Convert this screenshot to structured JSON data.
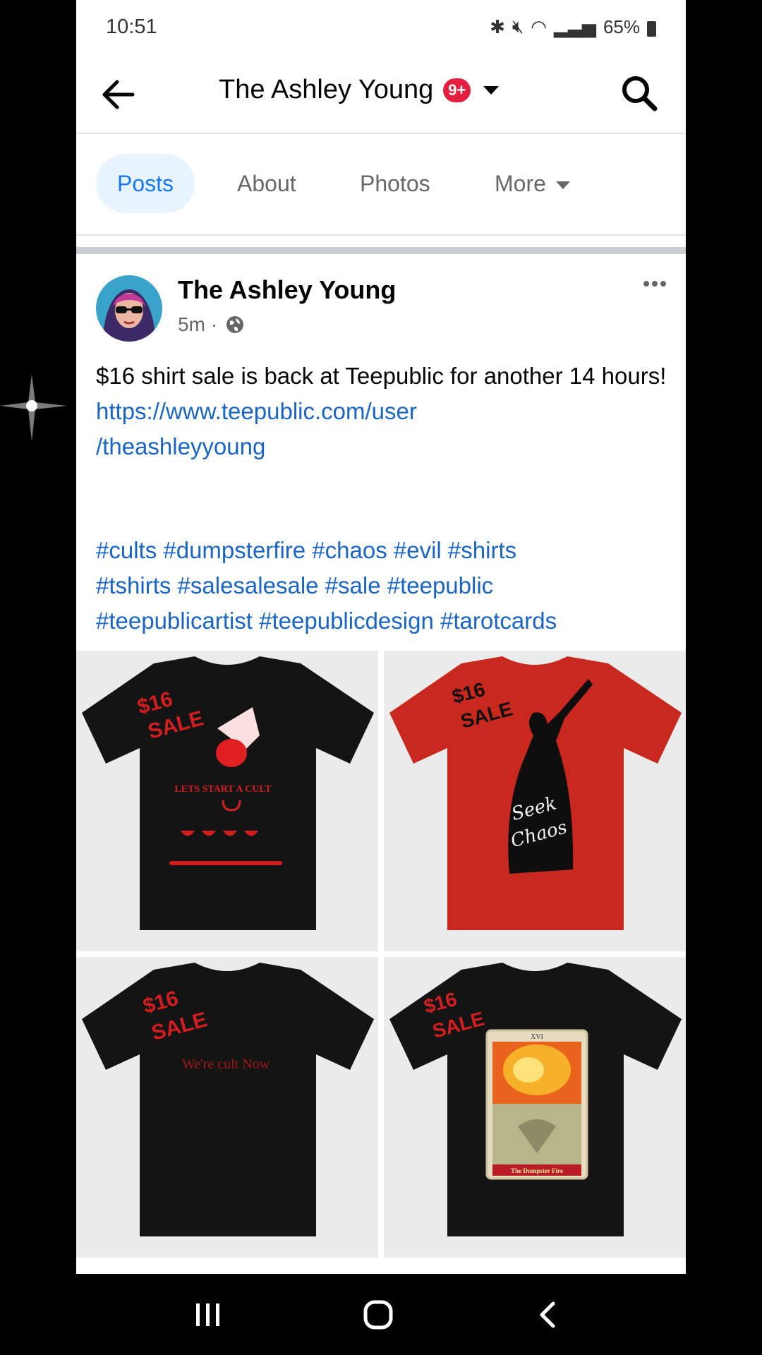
{
  "status_bar": {
    "time": "10:51",
    "battery": "65%"
  },
  "header": {
    "title": "The Ashley Young",
    "notification_badge": "9+"
  },
  "tabs": [
    {
      "label": "Posts",
      "active": true
    },
    {
      "label": "About",
      "active": false
    },
    {
      "label": "Photos",
      "active": false
    },
    {
      "label": "More",
      "active": false
    }
  ],
  "post": {
    "author": "The Ashley Young",
    "time": "5m",
    "separator": "·",
    "text": "$16 shirt sale is back at Teepublic for another 14 hours!",
    "link_line1": "https://www.teepublic.com/user",
    "link_line2": "/theashleyyoung",
    "hashtags_line1": "#cults #dumpsterfire #chaos #evil #shirts",
    "hashtags_line2": "#tshirts #salesalesale #sale #teepublic",
    "hashtags_line3": "#teepublicartist #teepublicdesign #tarotcards",
    "images": [
      {
        "shirt_color": "#141414",
        "sale_text_1": "$16",
        "sale_text_2": "SALE",
        "design_text": "LETS START A CULT"
      },
      {
        "shirt_color": "#c8281e",
        "sale_text_1": "$16",
        "sale_text_2": "SALE",
        "design_text_1": "Seek",
        "design_text_2": "Chaos"
      },
      {
        "shirt_color": "#141414",
        "sale_text_1": "$16",
        "sale_text_2": "SALE",
        "design_text": "We're cult Now"
      },
      {
        "shirt_color": "#141414",
        "sale_text_1": "$16",
        "sale_text_2": "SALE",
        "card_number": "XVI",
        "card_title": "The Dumpster Fire"
      }
    ]
  },
  "colors": {
    "accent": "#1877f2",
    "link": "#1a65c4",
    "badge": "#e41e3f",
    "sale_red": "#d21e1e"
  }
}
